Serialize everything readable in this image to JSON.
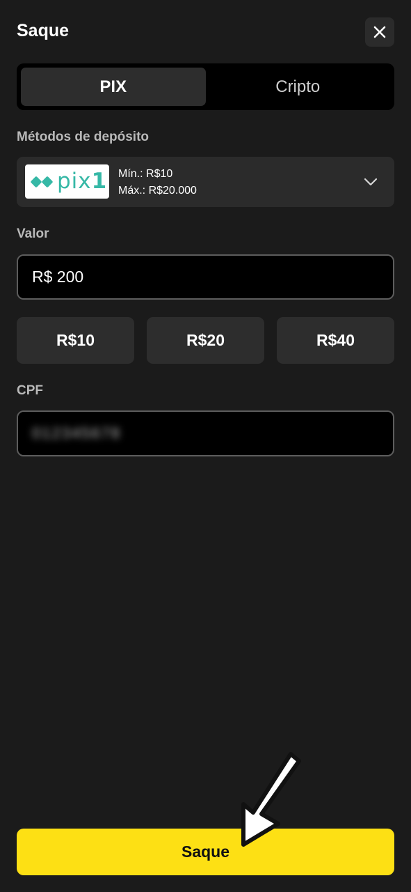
{
  "header": {
    "title": "Saque",
    "close_icon": "close-icon"
  },
  "tabs": [
    {
      "label": "PIX",
      "active": true
    },
    {
      "label": "Cripto",
      "active": false
    }
  ],
  "deposit_methods": {
    "label": "Métodos de depósito",
    "selected": {
      "logo_text": "pix",
      "logo_suffix": "1",
      "min": "Mín.: R$10",
      "max": "Máx.: R$20.000"
    }
  },
  "amount": {
    "label": "Valor",
    "value": "R$ 200"
  },
  "quick_amounts": [
    "R$10",
    "R$20",
    "R$40"
  ],
  "cpf": {
    "label": "CPF",
    "value_obscured": "012345678"
  },
  "submit": {
    "label": "Saque"
  },
  "colors": {
    "background": "#1b1b1b",
    "accent": "#fde014",
    "pix_brand": "#36b8a6"
  }
}
